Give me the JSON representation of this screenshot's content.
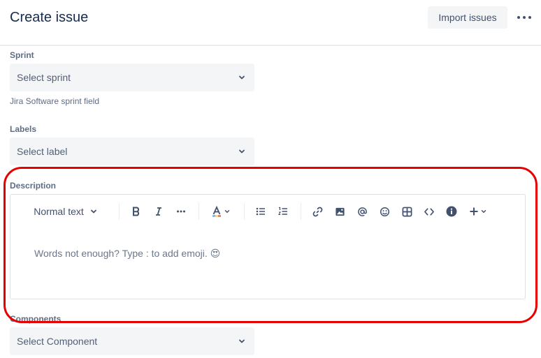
{
  "header": {
    "title": "Create issue",
    "import_label": "Import issues"
  },
  "fields": {
    "sprint": {
      "label": "Sprint",
      "placeholder": "Select sprint",
      "helper": "Jira Software sprint field"
    },
    "labels": {
      "label": "Labels",
      "placeholder": "Select label"
    },
    "description": {
      "label": "Description",
      "text_style": "Normal text",
      "placeholder": "Words not enough? Type : to add emoji.",
      "emoji": "😍"
    },
    "components": {
      "label": "Components",
      "placeholder": "Select Component"
    }
  },
  "toolbar_icons": [
    "bold-icon",
    "italic-icon",
    "more-formatting-icon",
    "text-color-icon",
    "bullet-list-icon",
    "numbered-list-icon",
    "link-icon",
    "image-icon",
    "mention-icon",
    "emoji-icon",
    "table-icon",
    "code-icon",
    "info-icon",
    "insert-plus-icon"
  ],
  "colors": {
    "highlight": "#e60000",
    "field_bg": "#f4f5f7",
    "text": "#172b4d"
  }
}
